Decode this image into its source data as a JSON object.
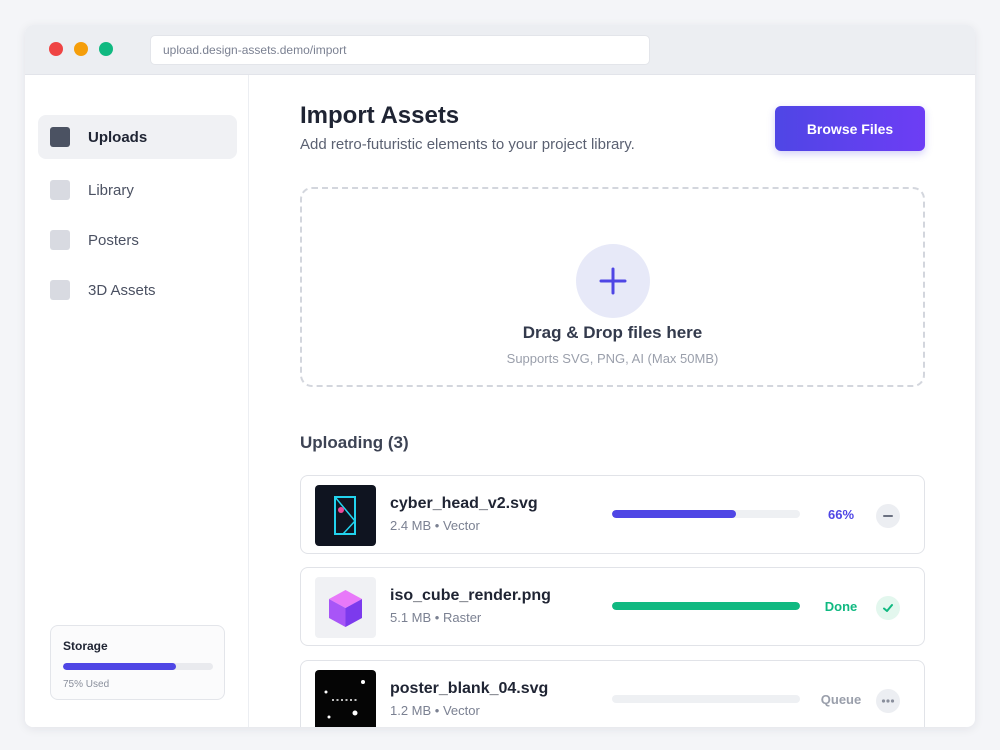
{
  "browser": {
    "url": "upload.design-assets.demo/import"
  },
  "sidebar": {
    "items": [
      {
        "label": "Uploads",
        "active": true
      },
      {
        "label": "Library",
        "active": false
      },
      {
        "label": "Posters",
        "active": false
      },
      {
        "label": "3D Assets",
        "active": false
      }
    ],
    "storage": {
      "title": "Storage",
      "used_percent": 75,
      "used_text": "75% Used"
    }
  },
  "header": {
    "title": "Import Assets",
    "subtitle": "Add retro-futuristic elements to your project library.",
    "browse_label": "Browse Files"
  },
  "dropzone": {
    "title": "Drag & Drop files here",
    "hint": "Supports SVG, PNG, AI (Max 50MB)"
  },
  "uploads": {
    "title": "Uploading (3)",
    "files": [
      {
        "name": "cyber_head_v2.svg",
        "meta": "2.4 MB • Vector",
        "progress": 66,
        "status": "66%",
        "status_color": "#4f46e5",
        "bar_color": "#4f46e5",
        "action": "minus-icon"
      },
      {
        "name": "iso_cube_render.png",
        "meta": "5.1 MB • Raster",
        "progress": 100,
        "status": "Done",
        "status_color": "#10b981",
        "bar_color": "#10b981",
        "action": "check-icon"
      },
      {
        "name": "poster_blank_04.svg",
        "meta": "1.2 MB • Vector",
        "progress": 0,
        "status": "Queue",
        "status_color": "#9a9fab",
        "bar_color": "#d8dae1",
        "action": "more-icon"
      }
    ]
  },
  "colors": {
    "accent": "#4f46e5",
    "success": "#10b981"
  }
}
